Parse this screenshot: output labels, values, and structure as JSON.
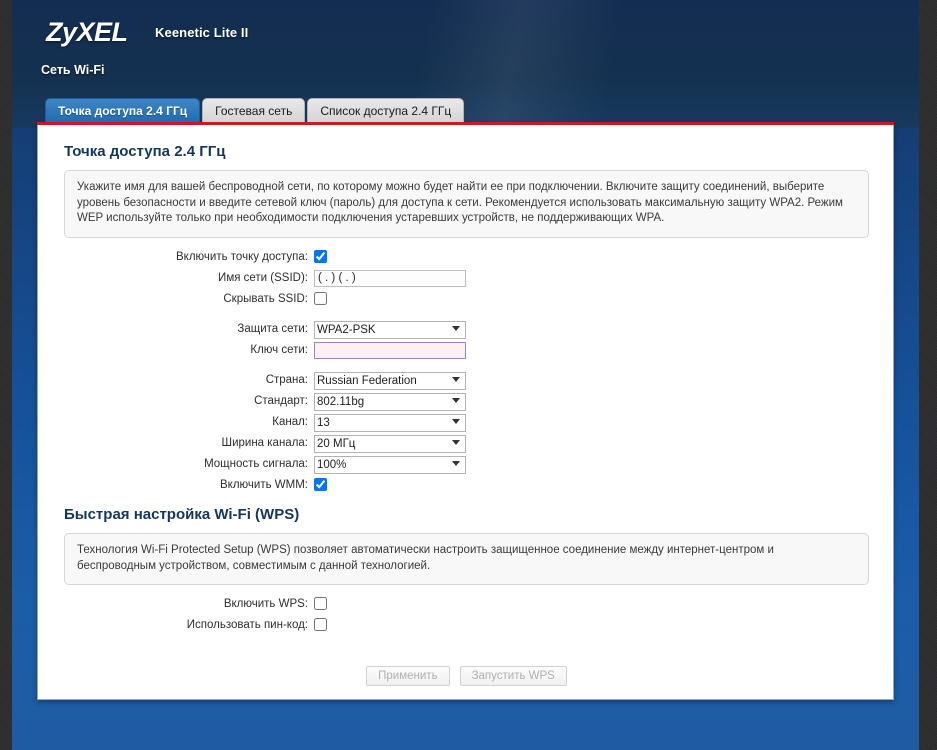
{
  "header": {
    "logo": "ZyXEL",
    "model": "Keenetic Lite II",
    "breadcrumb": "Сеть Wi-Fi"
  },
  "tabs": [
    {
      "label": "Точка доступа 2.4 ГГц",
      "active": true
    },
    {
      "label": "Гостевая сеть",
      "active": false
    },
    {
      "label": "Список доступа 2.4 ГГц",
      "active": false
    }
  ],
  "access_point": {
    "title": "Точка доступа 2.4 ГГц",
    "info": "Укажите имя для вашей беспроводной сети, по которому можно будет найти ее при подключении. Включите защиту соединений, выберите уровень безопасности и введите сетевой ключ (пароль) для доступа к сети. Рекомендуется использовать максимальную защиту WPA2. Режим WEP используйте только при необходимости подключения устаревших устройств, не поддерживающих WPA.",
    "fields": {
      "enable_ap_label": "Включить точку доступа:",
      "enable_ap_checked": true,
      "ssid_label": "Имя сети (SSID):",
      "ssid_value": "( . ) ( . )",
      "hide_ssid_label": "Скрывать SSID:",
      "hide_ssid_checked": false,
      "security_label": "Защита сети:",
      "security_value": "WPA2-PSK",
      "security_options": [
        "WPA2-PSK"
      ],
      "key_label": "Ключ сети:",
      "key_value": "",
      "country_label": "Страна:",
      "country_value": "Russian Federation",
      "country_options": [
        "Russian Federation"
      ],
      "standard_label": "Стандарт:",
      "standard_value": "802.11bg",
      "standard_options": [
        "802.11bg"
      ],
      "channel_label": "Канал:",
      "channel_value": "13",
      "channel_options": [
        "13"
      ],
      "width_label": "Ширина канала:",
      "width_value": "20 МГц",
      "width_options": [
        "20 МГц"
      ],
      "power_label": "Мощность сигнала:",
      "power_value": "100%",
      "power_options": [
        "100%"
      ],
      "wmm_label": "Включить WMM:",
      "wmm_checked": true
    }
  },
  "wps": {
    "title": "Быстрая настройка Wi-Fi (WPS)",
    "info": "Технология Wi-Fi Protected Setup (WPS) позволяет автоматически настроить защищенное соединение между интернет-центром и беспроводным устройством, совместимым с данной технологией.",
    "fields": {
      "enable_wps_label": "Включить WPS:",
      "enable_wps_checked": false,
      "use_pin_label": "Использовать пин-код:",
      "use_pin_checked": false
    }
  },
  "buttons": {
    "apply": "Применить",
    "start_wps": "Запустить WPS"
  },
  "colors": {
    "accent_red": "#cf1626",
    "header_blue": "#132d52",
    "tab_active": "#1e6bb0",
    "title_navy": "#14375f"
  }
}
